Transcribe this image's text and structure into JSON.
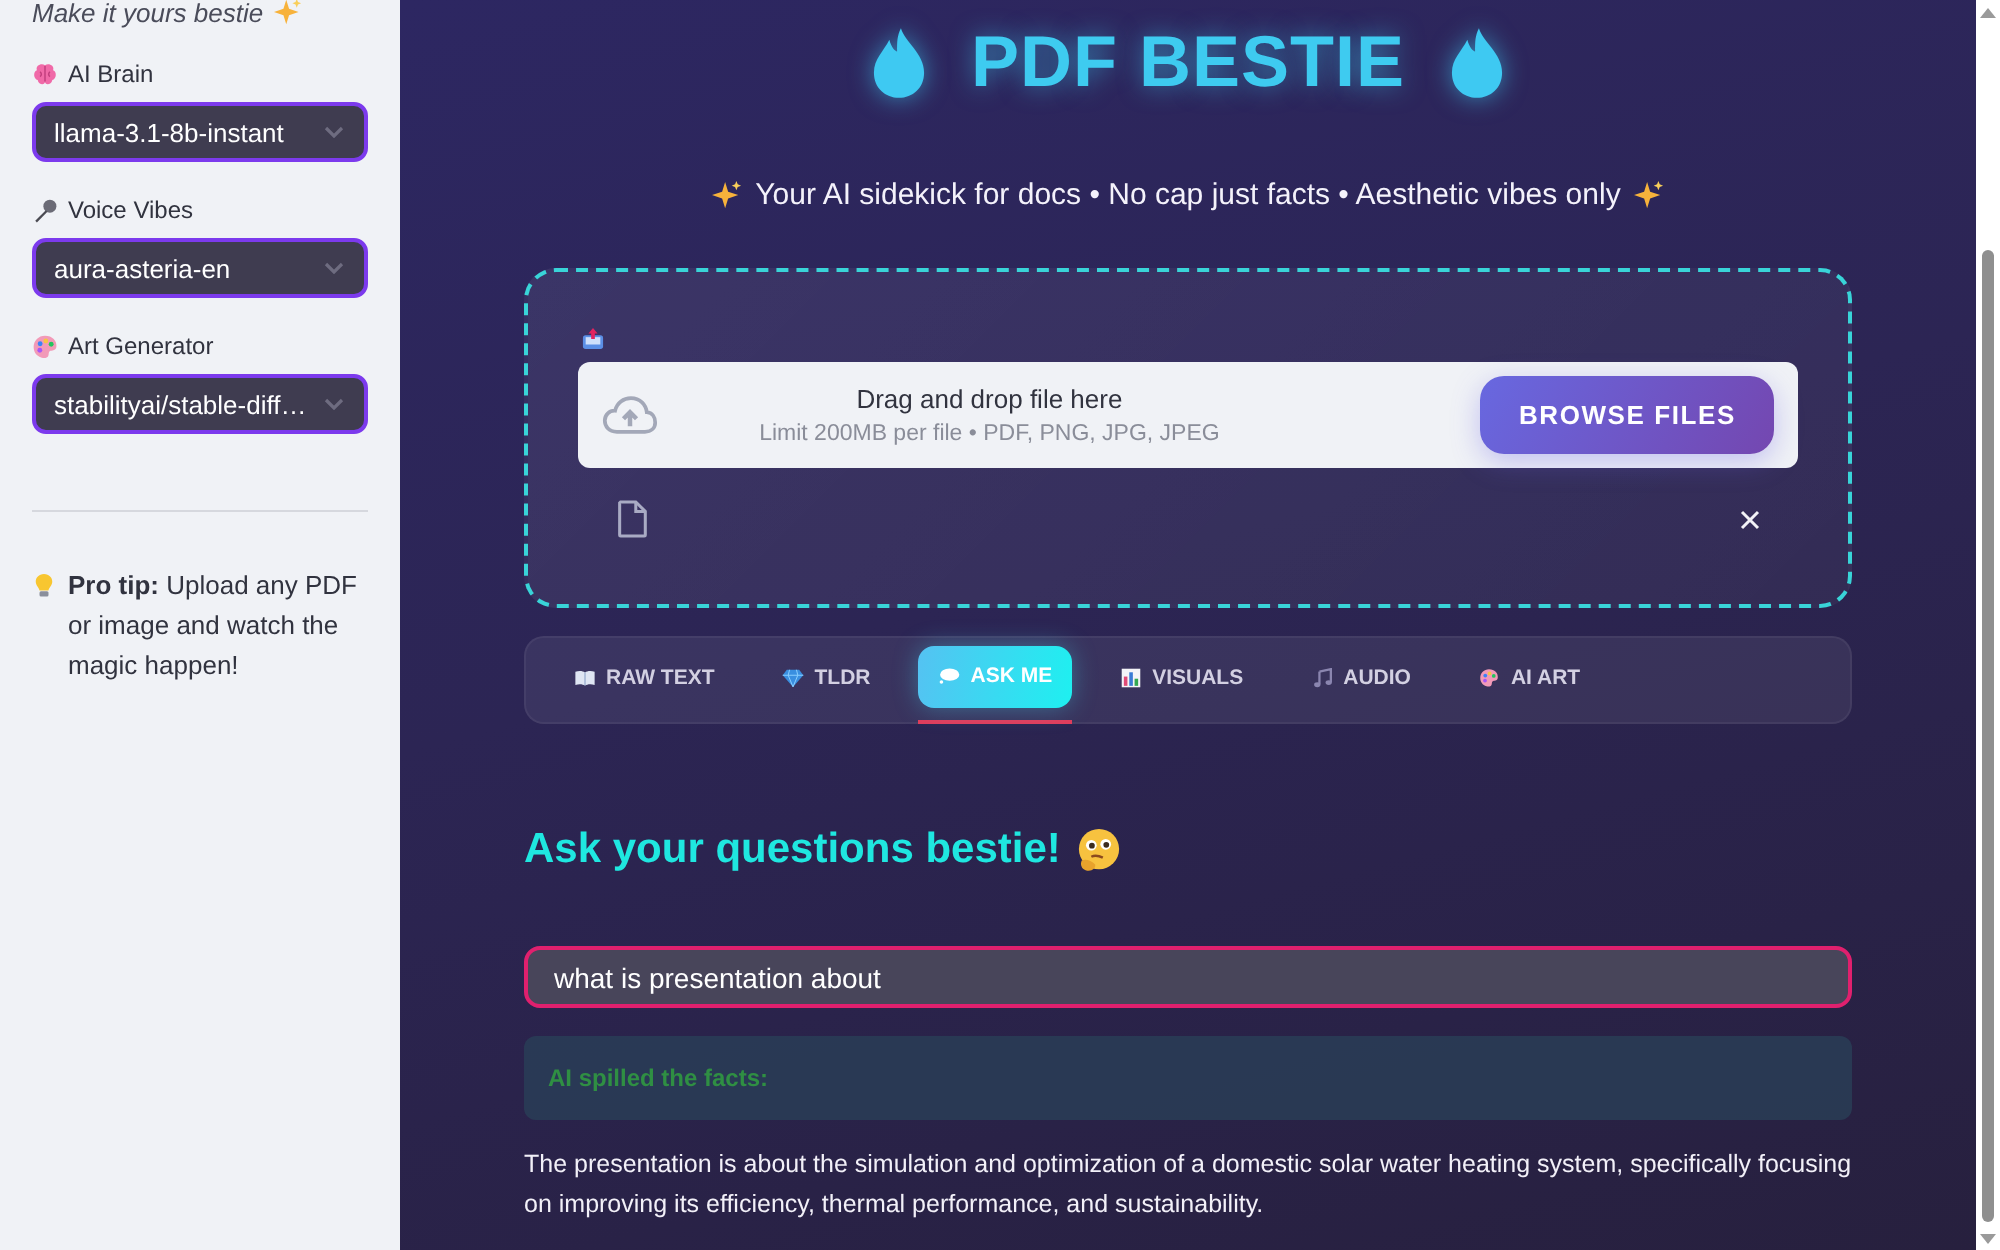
{
  "sidebar": {
    "caption": "Make it yours bestie",
    "selects": [
      {
        "label": "AI Brain",
        "value": "llama-3.1-8b-instant"
      },
      {
        "label": "Voice Vibes",
        "value": "aura-asteria-en"
      },
      {
        "label": "Art Generator",
        "value": "stabilityai/stable-diff…"
      }
    ],
    "pro_tip": "**Pro tip:** Upload any PDF or image and watch the magic happen!"
  },
  "header": {
    "title": "PDF BESTIE",
    "tagline": "Your AI sidekick for docs • No cap just facts • Aesthetic vibes only"
  },
  "uploader": {
    "dropzone": {
      "instruction": "Drag and drop file here",
      "limits": "Limit 200MB per file • PDF, PNG, JPG, JPEG",
      "button": "BROWSE FILES"
    }
  },
  "tabs": [
    {
      "label": "RAW TEXT",
      "selected": false
    },
    {
      "label": "TLDR",
      "selected": false
    },
    {
      "label": "ASK ME",
      "selected": true
    },
    {
      "label": "VISUALS",
      "selected": false
    },
    {
      "label": "AUDIO",
      "selected": false
    },
    {
      "label": "AI ART",
      "selected": false
    }
  ],
  "ask": {
    "heading": "Ask your questions bestie!",
    "question": {
      "value": "what is presentation about"
    },
    "answer_label": "AI spilled the facts:",
    "answer": "The presentation is about the simulation and optimization of a domestic solar water heating system, specifically focusing on improving its efficiency, thermal performance, and sustainability."
  }
}
